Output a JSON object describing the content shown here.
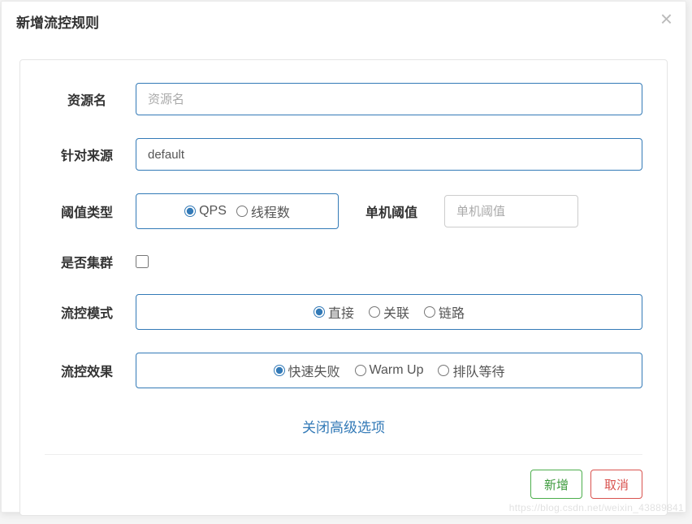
{
  "modal": {
    "title": "新增流控规则",
    "close_icon": "×"
  },
  "form": {
    "resource": {
      "label": "资源名",
      "placeholder": "资源名",
      "value": ""
    },
    "source": {
      "label": "针对来源",
      "value": "default"
    },
    "threshold_type": {
      "label": "阈值类型",
      "options": {
        "qps": "QPS",
        "threads": "线程数"
      },
      "selected": "qps"
    },
    "threshold_value": {
      "label": "单机阈值",
      "placeholder": "单机阈值",
      "value": ""
    },
    "cluster": {
      "label": "是否集群",
      "checked": false
    },
    "mode": {
      "label": "流控模式",
      "options": {
        "direct": "直接",
        "relate": "关联",
        "chain": "链路"
      },
      "selected": "direct"
    },
    "effect": {
      "label": "流控效果",
      "options": {
        "fail_fast": "快速失败",
        "warm_up": "Warm Up",
        "queue": "排队等待"
      },
      "selected": "fail_fast"
    },
    "advanced_link": "关闭高级选项"
  },
  "footer": {
    "submit": "新增",
    "cancel": "取消"
  },
  "watermark": "https://blog.csdn.net/weixin_43889841"
}
